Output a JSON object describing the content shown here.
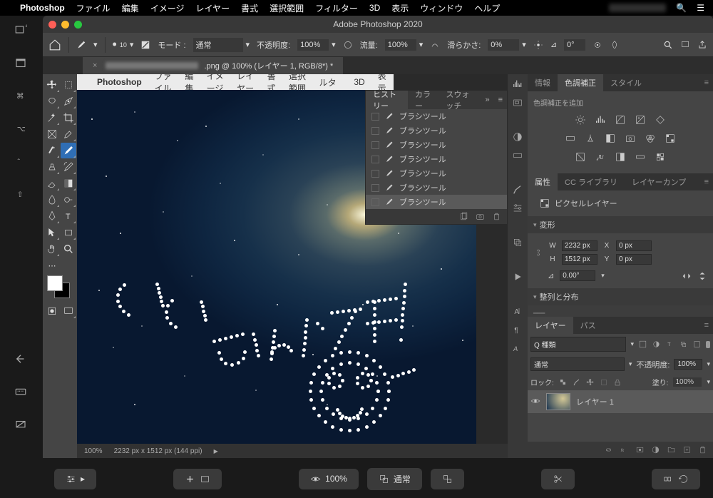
{
  "macMenu": {
    "appName": "Photoshop",
    "items": [
      "ファイル",
      "編集",
      "イメージ",
      "レイヤー",
      "書式",
      "選択範囲",
      "フィルター",
      "3D",
      "表示",
      "ウィンドウ",
      "ヘルプ"
    ]
  },
  "window": {
    "title": "Adobe Photoshop 2020"
  },
  "options": {
    "home": "⌂",
    "brushSize": "10",
    "modeLabel": "モード :",
    "mode": "通常",
    "opacityLabel": "不透明度:",
    "opacity": "100%",
    "flowLabel": "流量:",
    "flow": "100%",
    "smoothLabel": "滑らかさ:",
    "smooth": "0%",
    "angle": "0°"
  },
  "docTab": {
    "suffix": ".png @ 100% (レイヤー 1, RGB/8*) *"
  },
  "canvasMenu": {
    "items": [
      "Photoshop",
      "ファイル",
      "編集",
      "イメージ",
      "レイヤー",
      "書式",
      "選択範囲",
      "フィルター",
      "3D",
      "表示"
    ]
  },
  "history": {
    "tabs": [
      "ヒストリー",
      "カラー",
      "スウォッチ"
    ],
    "rows": [
      "ブラシツール",
      "ブラシツール",
      "ブラシツール",
      "ブラシツール",
      "ブラシツール",
      "ブラシツール",
      "ブラシツール"
    ]
  },
  "status": {
    "zoom": "100%",
    "dims": "2232 px x 1512 px (144 ppi)"
  },
  "adjustments": {
    "tabs": [
      "情報",
      "色調補正",
      "スタイル"
    ],
    "addLabel": "色調補正を追加"
  },
  "properties": {
    "tabs": [
      "属性",
      "CC ライブラリ",
      "レイヤーカンプ"
    ],
    "pixelLayer": "ピクセルレイヤー",
    "transformHead": "変形",
    "w": "2232 px",
    "h": "1512 px",
    "x": "0 px",
    "y": "0 px",
    "angle": "0.00°",
    "alignHead": "整列と分布"
  },
  "layers": {
    "tabs": [
      "レイヤー",
      "パス"
    ],
    "search": "Q 種類",
    "blendMode": "通常",
    "opacityLabel": "不透明度:",
    "opacity": "100%",
    "lockLabel": "ロック:",
    "fillLabel": "塗り:",
    "fill": "100%",
    "layerName": "レイヤー 1"
  },
  "bottomBar": {
    "zoom": "100%",
    "mode": "通常"
  }
}
